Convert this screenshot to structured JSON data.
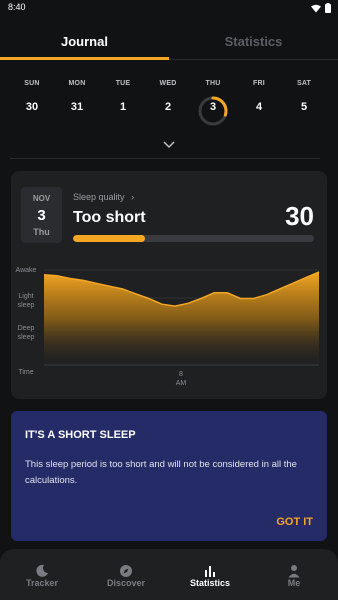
{
  "status": {
    "time": "8:40"
  },
  "tabs": [
    {
      "label": "Journal",
      "active": true
    },
    {
      "label": "Statistics",
      "active": false
    }
  ],
  "week": [
    {
      "name": "SUN",
      "date": "30"
    },
    {
      "name": "MON",
      "date": "31"
    },
    {
      "name": "TUE",
      "date": "1"
    },
    {
      "name": "WED",
      "date": "2"
    },
    {
      "name": "THU",
      "date": "3",
      "selected": true,
      "progress": 0.3
    },
    {
      "name": "FRI",
      "date": "4"
    },
    {
      "name": "SAT",
      "date": "5"
    }
  ],
  "sleep": {
    "month": "NOV",
    "day": "3",
    "weekday": "Thu",
    "quality_label": "Sleep quality",
    "quality_title": "Too short",
    "score": "30",
    "score_fraction": 0.3
  },
  "chart_data": {
    "type": "area",
    "y_levels": [
      "Awake",
      "Light sleep",
      "Deep sleep"
    ],
    "bottom_label": "Time",
    "x_tick": {
      "label_line1": "8",
      "label_line2": "AM"
    },
    "values": [
      0.05,
      0.06,
      0.09,
      0.11,
      0.14,
      0.17,
      0.2,
      0.25,
      0.3,
      0.36,
      0.38,
      0.35,
      0.3,
      0.24,
      0.24,
      0.3,
      0.3,
      0.26,
      0.2,
      0.14,
      0.08,
      0.02
    ],
    "accent": "#f5a623"
  },
  "notice": {
    "title": "IT'S A SHORT SLEEP",
    "body": "This sleep period is too short and will not be considered in all the calculations.",
    "button": "GOT IT"
  },
  "nav": [
    {
      "label": "Tracker",
      "icon": "moon-icon",
      "active": false
    },
    {
      "label": "Discover",
      "icon": "compass-icon",
      "active": false
    },
    {
      "label": "Statistics",
      "icon": "bar-chart-icon",
      "active": true
    },
    {
      "label": "Me",
      "icon": "person-icon",
      "active": false
    }
  ],
  "colors": {
    "accent": "#f5a623",
    "notice_bg": "#242b66",
    "background": "#111214"
  }
}
